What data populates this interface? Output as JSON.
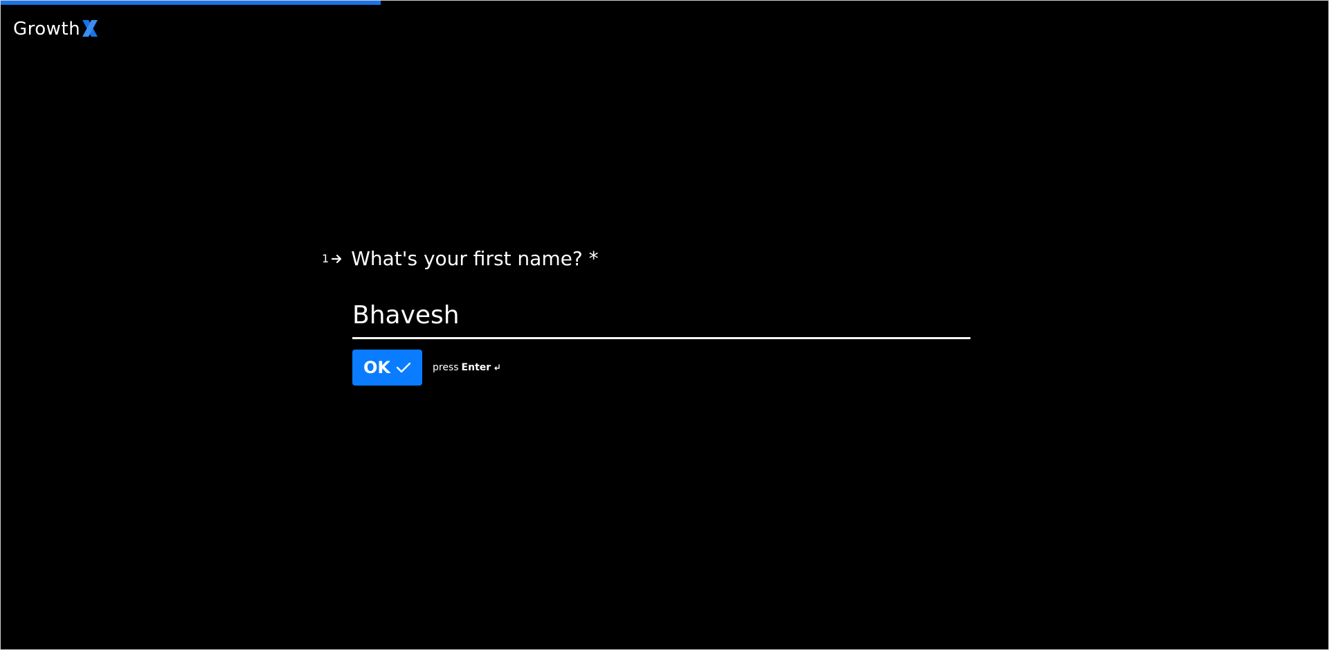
{
  "brand": {
    "logo_text": "Growth",
    "logo_accent": "X",
    "accent_color": "#1a73e8"
  },
  "progress": {
    "fraction": 0.286,
    "color": "#1a73e8"
  },
  "question": {
    "number": "1",
    "arrow_icon": "arrow-right-icon",
    "text": "What's your first name? *"
  },
  "answer": {
    "value": "Bhavesh",
    "placeholder": ""
  },
  "ok_button": {
    "label": "OK",
    "icon": "check-icon",
    "color": "#0a7cff"
  },
  "hint": {
    "prefix": "press",
    "key": "Enter",
    "icon": "enter-key-icon"
  }
}
